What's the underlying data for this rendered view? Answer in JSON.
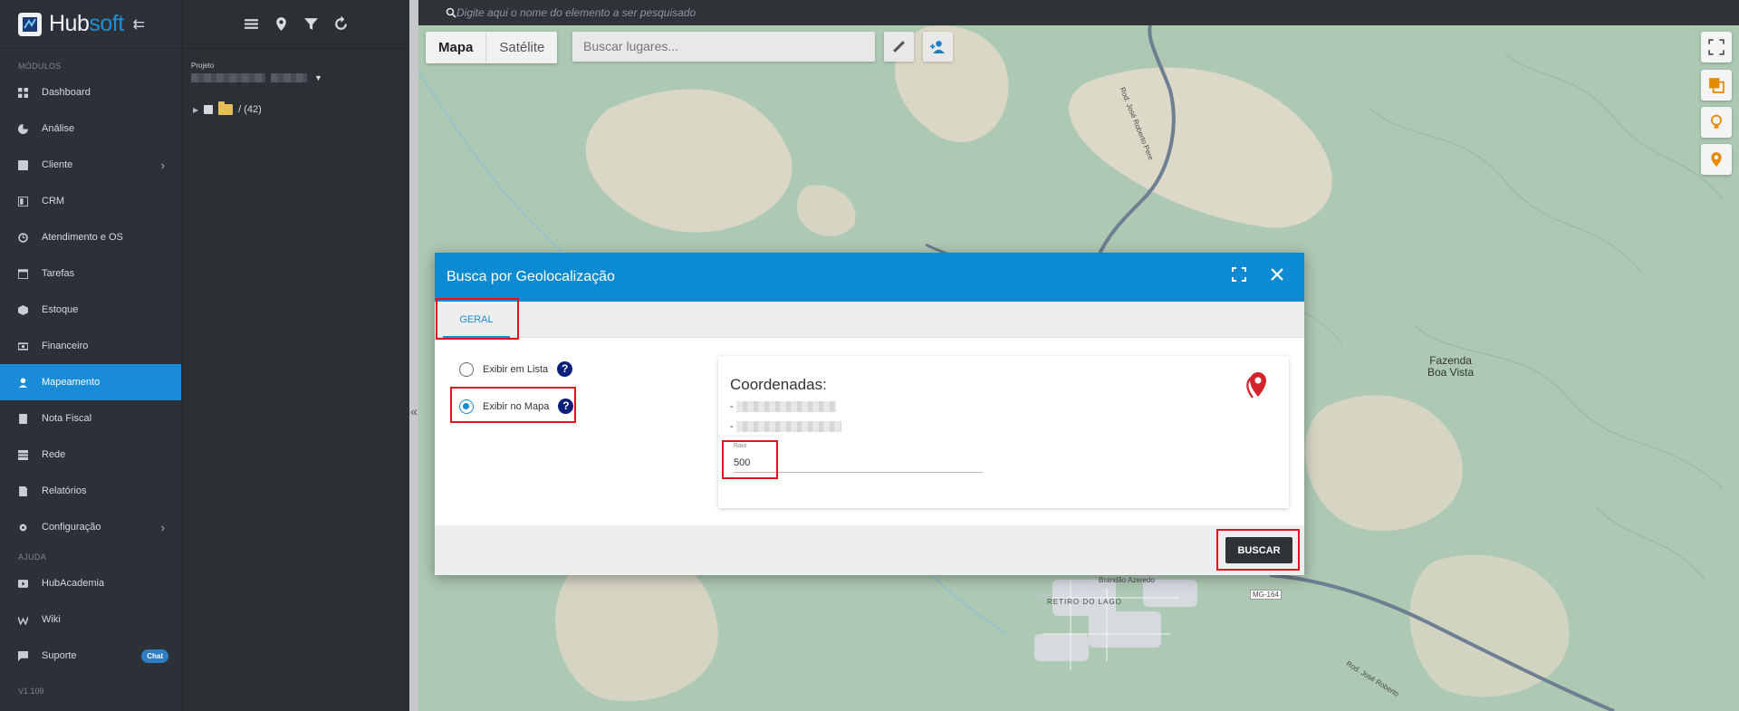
{
  "app": {
    "logo_main": "Hub",
    "logo_accent": "soft"
  },
  "sidebar": {
    "section_modules": "MÓDULOS",
    "section_help": "AJUDA",
    "items": [
      {
        "label": "Dashboard",
        "icon": "dashboard-icon"
      },
      {
        "label": "Análise",
        "icon": "chart-icon"
      },
      {
        "label": "Cliente",
        "icon": "contact-icon"
      },
      {
        "label": "CRM",
        "icon": "crm-icon"
      },
      {
        "label": "Atendimento e OS",
        "icon": "clock-icon"
      },
      {
        "label": "Tarefas",
        "icon": "calendar-icon"
      },
      {
        "label": "Estoque",
        "icon": "box-icon"
      },
      {
        "label": "Financeiro",
        "icon": "money-icon"
      },
      {
        "label": "Mapeamento",
        "icon": "map-person-icon"
      },
      {
        "label": "Nota Fiscal",
        "icon": "receipt-icon"
      },
      {
        "label": "Rede",
        "icon": "network-icon"
      },
      {
        "label": "Relatórios",
        "icon": "report-icon"
      },
      {
        "label": "Configuração",
        "icon": "gear-icon"
      }
    ],
    "help_items": [
      {
        "label": "HubAcademia",
        "icon": "play-icon"
      },
      {
        "label": "Wiki",
        "icon": "wiki-icon"
      },
      {
        "label": "Suporte",
        "icon": "chat-icon",
        "badge": "Chat"
      }
    ],
    "version": "V1.109"
  },
  "project": {
    "label": "Projeto",
    "tree_root": "/ (42)"
  },
  "map": {
    "search_placeholder": "Digite aqui o nome do elemento a ser pesquisado",
    "type_map": "Mapa",
    "type_satellite": "Satélite",
    "places_placeholder": "Buscar lugares...",
    "labels": {
      "fazenda": "Fazenda\nBoa Vista",
      "retiro": "RETIRO DO LAGO",
      "road1": "Rod. José Roberto Pere",
      "road2": "Rod. José Roberto",
      "brandao": "Brandão Azeredo",
      "mg164": "MG-164"
    }
  },
  "modal": {
    "title": "Busca por Geolocalização",
    "tab_geral": "GERAL",
    "option_list": "Exibir em Lista",
    "option_map": "Exibir no Mapa",
    "help_glyph": "?",
    "coords_title": "Coordenadas:",
    "coord_prefix": "-",
    "raio_label": "Raio",
    "raio_value": "500",
    "buscar": "BUSCAR"
  },
  "colors": {
    "accent": "#0d8bd2",
    "highlight": "#e1141c",
    "sidebar": "#2b3137"
  }
}
